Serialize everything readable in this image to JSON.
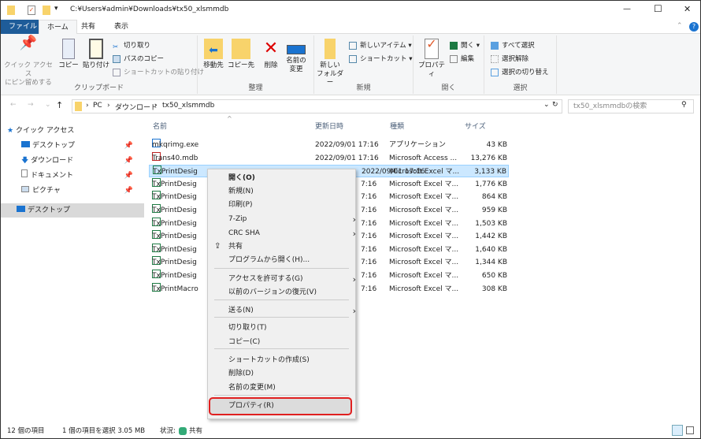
{
  "title_bar": {
    "path": "C:¥Users¥admin¥Downloads¥tx50_xlsmmdb",
    "minimize": "—",
    "maximize": "☐",
    "close": "✕"
  },
  "ribbon_tabs": [
    "ファイル",
    "ホーム",
    "共有",
    "表示"
  ],
  "ribbon": {
    "clipboard": {
      "label": "クリップボード",
      "pin": "クイック アクセス\nにピン留めする",
      "copy": "コピー",
      "paste": "貼り付け",
      "cut": "切り取り",
      "copy_path": "パスのコピー",
      "paste_shortcut": "ショートカットの貼り付け"
    },
    "organize": {
      "label": "整理",
      "move_to": "移動先",
      "copy_to": "コピー先",
      "delete": "削除",
      "rename": "名前の\n変更"
    },
    "new": {
      "label": "新規",
      "new_folder": "新しい\nフォルダー",
      "new_item": "新しいアイテム ▾",
      "shortcut": "ショートカット ▾"
    },
    "open": {
      "label": "開く",
      "properties": "プロパティ",
      "open": "開く ▾",
      "edit": "編集"
    },
    "select": {
      "label": "選択",
      "select_all": "すべて選択",
      "select_none": "選択解除",
      "invert": "選択の切り替え"
    }
  },
  "address": {
    "crumbs": [
      "PC",
      "ダウンロード",
      "tx50_xlsmmdb"
    ],
    "search_placeholder": "tx50_xlsmmdbの検索"
  },
  "nav": [
    {
      "label": "クイック アクセス"
    },
    {
      "label": "デスクトップ"
    },
    {
      "label": "ダウンロード"
    },
    {
      "label": "ドキュメント"
    },
    {
      "label": "ピクチャ"
    },
    {
      "label": "デスクトップ"
    }
  ],
  "columns": [
    "名前",
    "更新日時",
    "種類",
    "サイズ"
  ],
  "files": [
    {
      "name": "mkqrimg.exe",
      "date": "2022/09/01 17:16",
      "type": "アプリケーション",
      "size": "43 KB",
      "icon": "exe"
    },
    {
      "name": "Trans40.mdb",
      "date": "2022/09/01 17:16",
      "type": "Microsoft Access ...",
      "size": "13,276 KB",
      "icon": "access"
    },
    {
      "name": "TxPrintDesig",
      "date": "2022/09/01 17:16",
      "type": "Microsoft Excel マ...",
      "size": "3,133 KB",
      "icon": "excel"
    },
    {
      "name": "TxPrintDesig",
      "date": "7:16",
      "type": "Microsoft Excel マ...",
      "size": "1,776 KB",
      "icon": "excel"
    },
    {
      "name": "TxPrintDesig",
      "date": "7:16",
      "type": "Microsoft Excel マ...",
      "size": "864 KB",
      "icon": "excel"
    },
    {
      "name": "TxPrintDesig",
      "date": "7:16",
      "type": "Microsoft Excel マ...",
      "size": "959 KB",
      "icon": "excel"
    },
    {
      "name": "TxPrintDesig",
      "date": "7:16",
      "type": "Microsoft Excel マ...",
      "size": "1,503 KB",
      "icon": "excel"
    },
    {
      "name": "TxPrintDesig",
      "date": "7:16",
      "type": "Microsoft Excel マ...",
      "size": "1,442 KB",
      "icon": "excel"
    },
    {
      "name": "TxPrintDesig",
      "date": "7:16",
      "type": "Microsoft Excel マ...",
      "size": "1,640 KB",
      "icon": "excel"
    },
    {
      "name": "TxPrintDesig",
      "date": "7:16",
      "type": "Microsoft Excel マ...",
      "size": "1,344 KB",
      "icon": "excel"
    },
    {
      "name": "TxPrintDesig",
      "date": "7:16",
      "type": "Microsoft Excel マ...",
      "size": "650 KB",
      "icon": "excel"
    },
    {
      "name": "TxPrintMacro",
      "date": "7:16",
      "type": "Microsoft Excel マ...",
      "size": "308 KB",
      "icon": "excel"
    }
  ],
  "context_menu": [
    {
      "label": "開く(O)",
      "bold": true
    },
    {
      "label": "新規(N)"
    },
    {
      "label": "印刷(P)"
    },
    {
      "label": "7-Zip",
      "sub": true
    },
    {
      "label": "CRC SHA",
      "sub": true
    },
    {
      "label": "共有",
      "icon": "share-icon"
    },
    {
      "label": "プログラムから開く(H)..."
    },
    {
      "label": "アクセスを許可する(G)",
      "sub": true
    },
    {
      "label": "以前のバージョンの復元(V)"
    },
    {
      "label": "送る(N)",
      "sub": true
    },
    {
      "label": "切り取り(T)"
    },
    {
      "label": "コピー(C)"
    },
    {
      "label": "ショートカットの作成(S)"
    },
    {
      "label": "削除(D)"
    },
    {
      "label": "名前の変更(M)"
    },
    {
      "label": "プロパティ(R)",
      "highlight": true
    }
  ],
  "status": {
    "count": "12 個の項目",
    "selected": "1 個の項目を選択  3.05 MB",
    "state": "状況:",
    "shared": "共有"
  },
  "colors": {
    "accent": "#1e5c99",
    "selection": "#cce8ff",
    "highlight_border": "#e02020"
  }
}
